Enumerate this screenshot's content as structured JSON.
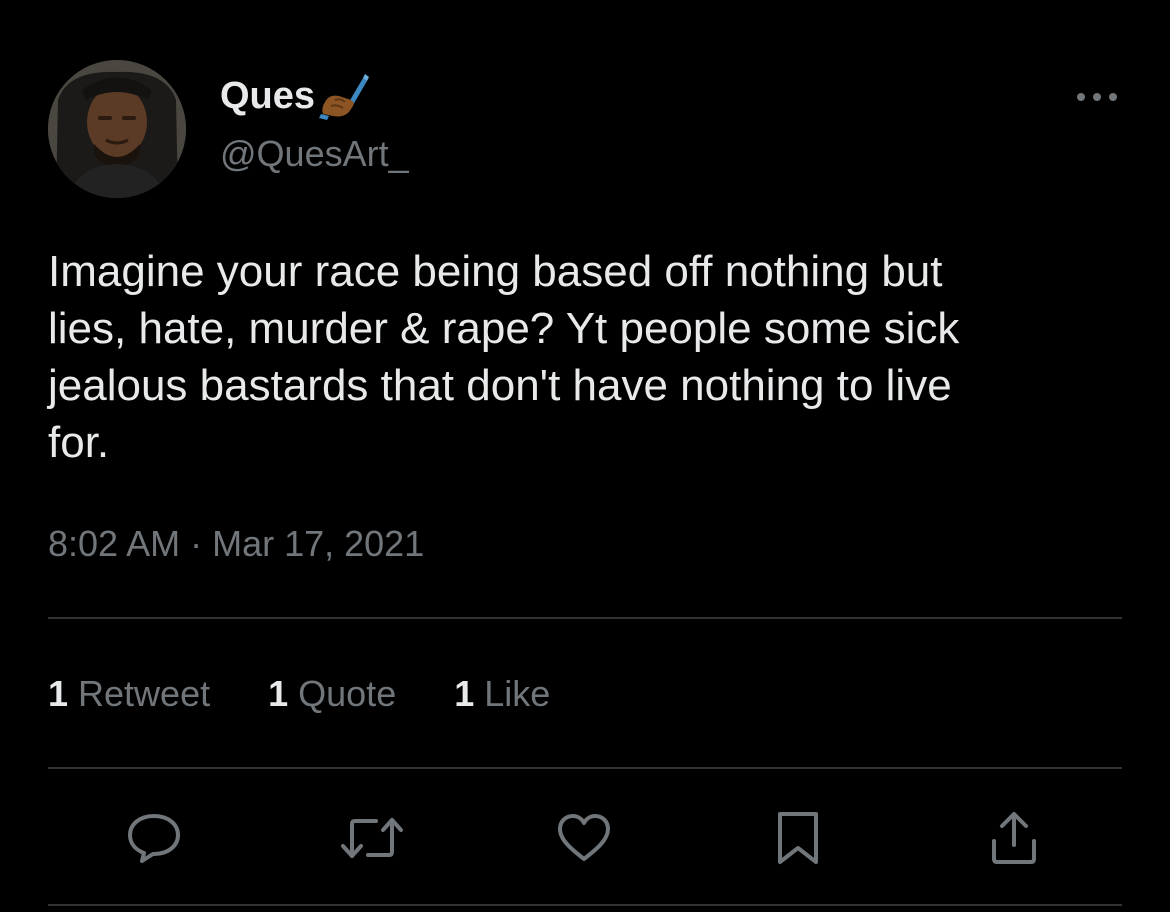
{
  "author": {
    "display_name": "Ques",
    "name_emoji": "writing-hand-emoji",
    "handle": "@QuesArt_"
  },
  "tweet": {
    "text_lines": [
      "Imagine your race being based off nothing but",
      "lies, hate, murder & rape? Yt people some sick",
      "jealous bastards that don't have nothing to live",
      "for."
    ],
    "timestamp": "8:02 AM · Mar 17, 2021"
  },
  "stats": {
    "retweets": {
      "count": "1",
      "label": "Retweet"
    },
    "quotes": {
      "count": "1",
      "label": "Quote"
    },
    "likes": {
      "count": "1",
      "label": "Like"
    }
  },
  "actions": [
    {
      "icon": "reply-icon"
    },
    {
      "icon": "retweet-icon"
    },
    {
      "icon": "like-icon"
    },
    {
      "icon": "bookmark-icon"
    },
    {
      "icon": "share-icon"
    }
  ],
  "colors": {
    "background": "#000000",
    "primary_text": "#e7e9ea",
    "secondary_text": "#71767b",
    "divider": "#2f3336"
  }
}
